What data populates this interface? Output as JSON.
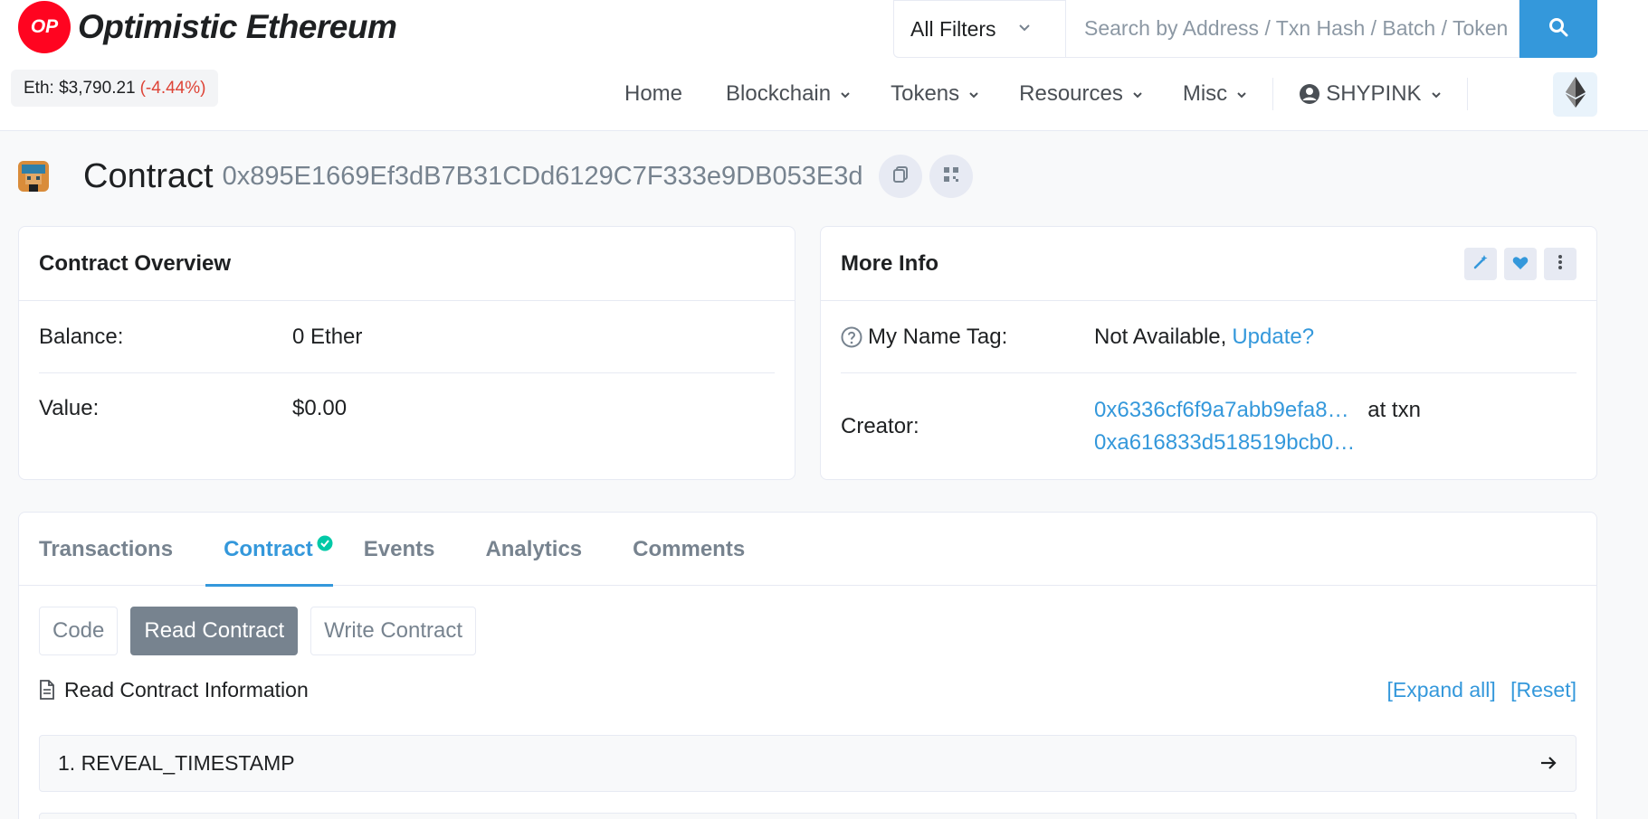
{
  "brand": {
    "logo_badge": "OP",
    "name": "Optimistic Ethereum",
    "color": "#ff0420"
  },
  "price": {
    "label": "Eth: $3,790.21",
    "change": "(-4.44%)"
  },
  "search": {
    "filter": "All Filters",
    "placeholder": "Search by Address / Txn Hash / Batch / Token"
  },
  "nav": {
    "items": [
      "Home",
      "Blockchain",
      "Tokens",
      "Resources",
      "Misc"
    ],
    "user": "SHYPINK"
  },
  "page": {
    "title": "Contract",
    "address": "0x895E1669Ef3dB7B31CDd6129C7F333e9DB053E3d"
  },
  "overview": {
    "title": "Contract Overview",
    "balance_label": "Balance:",
    "balance_value": "0 Ether",
    "value_label": "Value:",
    "value_value": "$0.00"
  },
  "more_info": {
    "title": "More Info",
    "name_tag_label": "My Name Tag:",
    "name_tag_value": "Not Available,",
    "name_tag_link": "Update?",
    "creator_label": "Creator:",
    "creator_address": "0x6336cf6f9a7abb9efa8…",
    "creator_at": "at txn",
    "creator_txn": "0xa616833d518519bcb0…"
  },
  "tabs": [
    "Transactions",
    "Contract",
    "Events",
    "Analytics",
    "Comments"
  ],
  "subtabs": [
    "Code",
    "Read Contract",
    "Write Contract"
  ],
  "read_info": {
    "title": "Read Contract Information",
    "expand": "[Expand all]",
    "reset": "[Reset]"
  },
  "functions": [
    "1. REVEAL_TIMESTAMP"
  ],
  "colors": {
    "accent": "#3498db",
    "danger": "#de4437",
    "secondary": "#77838f"
  }
}
